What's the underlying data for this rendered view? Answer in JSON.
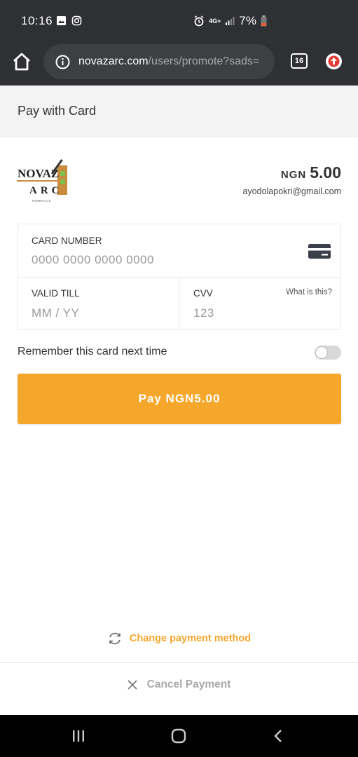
{
  "status_bar": {
    "time": "10:16",
    "network": "4G+",
    "battery": "7%",
    "battery_color": "#e8613a"
  },
  "browser": {
    "url_host": "novazarc.com",
    "url_path": "/users/promote?sads=",
    "tab_count": "16"
  },
  "header": {
    "title": "Pay with Card"
  },
  "merchant": {
    "logo_line1": "NOVAZ",
    "logo_line2": "ARC",
    "logo_sub": "PROPERTY LTD",
    "currency": "NGN",
    "amount": "5.00",
    "email": "ayodolapokri@gmail.com"
  },
  "card_form": {
    "card_number_label": "CARD NUMBER",
    "card_number_placeholder": "0000 0000 0000 0000",
    "valid_till_label": "VALID TILL",
    "valid_till_placeholder": "MM / YY",
    "cvv_label": "CVV",
    "cvv_placeholder": "123",
    "cvv_help": "What is this?"
  },
  "remember": {
    "label": "Remember this card next time",
    "enabled": false
  },
  "pay_button": {
    "label": "Pay NGN5.00"
  },
  "footer": {
    "change_method_label": "Change payment method",
    "cancel_label": "Cancel Payment"
  },
  "colors": {
    "accent": "#f5a72b",
    "chrome": "#2f3033"
  },
  "icons": [
    "image-icon",
    "instagram-icon",
    "alarm-icon",
    "signal-icon",
    "battery-icon",
    "home-icon",
    "info-icon",
    "tabs-icon",
    "upload-icon",
    "credit-card-icon",
    "refresh-icon",
    "close-icon",
    "recents-icon",
    "home-nav-icon",
    "back-icon"
  ]
}
